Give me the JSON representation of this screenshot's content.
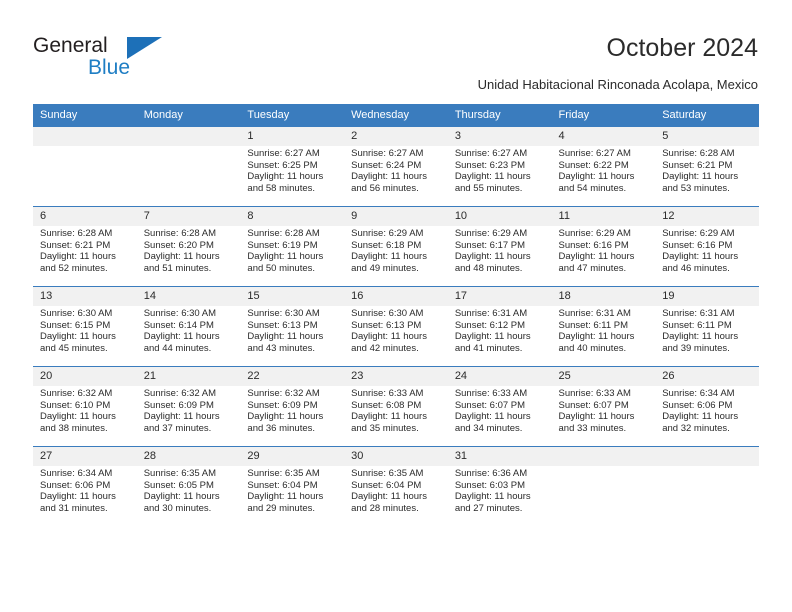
{
  "brand": {
    "line1": "General",
    "line2": "Blue",
    "triangle_color": "#1d70b8"
  },
  "header": {
    "title": "October 2024",
    "subtitle": "Unidad Habitacional Rinconada Acolapa, Mexico"
  },
  "theme": {
    "header_blue": "#3a7cbe",
    "daynum_gray": "#f1f1f1",
    "text": "#2b2b2b",
    "brand_blue": "#1f7ec4"
  },
  "calendar": {
    "weekday_headers": [
      "Sunday",
      "Monday",
      "Tuesday",
      "Wednesday",
      "Thursday",
      "Friday",
      "Saturday"
    ],
    "labels": {
      "sunrise": "Sunrise:",
      "sunset": "Sunset:",
      "daylight": "Daylight:"
    },
    "weeks": [
      [
        {
          "day": "",
          "sunrise": "",
          "sunset": "",
          "daylight": "",
          "blank": true
        },
        {
          "day": "",
          "sunrise": "",
          "sunset": "",
          "daylight": "",
          "blank": true
        },
        {
          "day": "1",
          "sunrise": "Sunrise: 6:27 AM",
          "sunset": "Sunset: 6:25 PM",
          "daylight": "Daylight: 11 hours and 58 minutes."
        },
        {
          "day": "2",
          "sunrise": "Sunrise: 6:27 AM",
          "sunset": "Sunset: 6:24 PM",
          "daylight": "Daylight: 11 hours and 56 minutes."
        },
        {
          "day": "3",
          "sunrise": "Sunrise: 6:27 AM",
          "sunset": "Sunset: 6:23 PM",
          "daylight": "Daylight: 11 hours and 55 minutes."
        },
        {
          "day": "4",
          "sunrise": "Sunrise: 6:27 AM",
          "sunset": "Sunset: 6:22 PM",
          "daylight": "Daylight: 11 hours and 54 minutes."
        },
        {
          "day": "5",
          "sunrise": "Sunrise: 6:28 AM",
          "sunset": "Sunset: 6:21 PM",
          "daylight": "Daylight: 11 hours and 53 minutes."
        }
      ],
      [
        {
          "day": "6",
          "sunrise": "Sunrise: 6:28 AM",
          "sunset": "Sunset: 6:21 PM",
          "daylight": "Daylight: 11 hours and 52 minutes."
        },
        {
          "day": "7",
          "sunrise": "Sunrise: 6:28 AM",
          "sunset": "Sunset: 6:20 PM",
          "daylight": "Daylight: 11 hours and 51 minutes."
        },
        {
          "day": "8",
          "sunrise": "Sunrise: 6:28 AM",
          "sunset": "Sunset: 6:19 PM",
          "daylight": "Daylight: 11 hours and 50 minutes."
        },
        {
          "day": "9",
          "sunrise": "Sunrise: 6:29 AM",
          "sunset": "Sunset: 6:18 PM",
          "daylight": "Daylight: 11 hours and 49 minutes."
        },
        {
          "day": "10",
          "sunrise": "Sunrise: 6:29 AM",
          "sunset": "Sunset: 6:17 PM",
          "daylight": "Daylight: 11 hours and 48 minutes."
        },
        {
          "day": "11",
          "sunrise": "Sunrise: 6:29 AM",
          "sunset": "Sunset: 6:16 PM",
          "daylight": "Daylight: 11 hours and 47 minutes."
        },
        {
          "day": "12",
          "sunrise": "Sunrise: 6:29 AM",
          "sunset": "Sunset: 6:16 PM",
          "daylight": "Daylight: 11 hours and 46 minutes."
        }
      ],
      [
        {
          "day": "13",
          "sunrise": "Sunrise: 6:30 AM",
          "sunset": "Sunset: 6:15 PM",
          "daylight": "Daylight: 11 hours and 45 minutes."
        },
        {
          "day": "14",
          "sunrise": "Sunrise: 6:30 AM",
          "sunset": "Sunset: 6:14 PM",
          "daylight": "Daylight: 11 hours and 44 minutes."
        },
        {
          "day": "15",
          "sunrise": "Sunrise: 6:30 AM",
          "sunset": "Sunset: 6:13 PM",
          "daylight": "Daylight: 11 hours and 43 minutes."
        },
        {
          "day": "16",
          "sunrise": "Sunrise: 6:30 AM",
          "sunset": "Sunset: 6:13 PM",
          "daylight": "Daylight: 11 hours and 42 minutes."
        },
        {
          "day": "17",
          "sunrise": "Sunrise: 6:31 AM",
          "sunset": "Sunset: 6:12 PM",
          "daylight": "Daylight: 11 hours and 41 minutes."
        },
        {
          "day": "18",
          "sunrise": "Sunrise: 6:31 AM",
          "sunset": "Sunset: 6:11 PM",
          "daylight": "Daylight: 11 hours and 40 minutes."
        },
        {
          "day": "19",
          "sunrise": "Sunrise: 6:31 AM",
          "sunset": "Sunset: 6:11 PM",
          "daylight": "Daylight: 11 hours and 39 minutes."
        }
      ],
      [
        {
          "day": "20",
          "sunrise": "Sunrise: 6:32 AM",
          "sunset": "Sunset: 6:10 PM",
          "daylight": "Daylight: 11 hours and 38 minutes."
        },
        {
          "day": "21",
          "sunrise": "Sunrise: 6:32 AM",
          "sunset": "Sunset: 6:09 PM",
          "daylight": "Daylight: 11 hours and 37 minutes."
        },
        {
          "day": "22",
          "sunrise": "Sunrise: 6:32 AM",
          "sunset": "Sunset: 6:09 PM",
          "daylight": "Daylight: 11 hours and 36 minutes."
        },
        {
          "day": "23",
          "sunrise": "Sunrise: 6:33 AM",
          "sunset": "Sunset: 6:08 PM",
          "daylight": "Daylight: 11 hours and 35 minutes."
        },
        {
          "day": "24",
          "sunrise": "Sunrise: 6:33 AM",
          "sunset": "Sunset: 6:07 PM",
          "daylight": "Daylight: 11 hours and 34 minutes."
        },
        {
          "day": "25",
          "sunrise": "Sunrise: 6:33 AM",
          "sunset": "Sunset: 6:07 PM",
          "daylight": "Daylight: 11 hours and 33 minutes."
        },
        {
          "day": "26",
          "sunrise": "Sunrise: 6:34 AM",
          "sunset": "Sunset: 6:06 PM",
          "daylight": "Daylight: 11 hours and 32 minutes."
        }
      ],
      [
        {
          "day": "27",
          "sunrise": "Sunrise: 6:34 AM",
          "sunset": "Sunset: 6:06 PM",
          "daylight": "Daylight: 11 hours and 31 minutes."
        },
        {
          "day": "28",
          "sunrise": "Sunrise: 6:35 AM",
          "sunset": "Sunset: 6:05 PM",
          "daylight": "Daylight: 11 hours and 30 minutes."
        },
        {
          "day": "29",
          "sunrise": "Sunrise: 6:35 AM",
          "sunset": "Sunset: 6:04 PM",
          "daylight": "Daylight: 11 hours and 29 minutes."
        },
        {
          "day": "30",
          "sunrise": "Sunrise: 6:35 AM",
          "sunset": "Sunset: 6:04 PM",
          "daylight": "Daylight: 11 hours and 28 minutes."
        },
        {
          "day": "31",
          "sunrise": "Sunrise: 6:36 AM",
          "sunset": "Sunset: 6:03 PM",
          "daylight": "Daylight: 11 hours and 27 minutes."
        },
        {
          "day": "",
          "sunrise": "",
          "sunset": "",
          "daylight": "",
          "blank": true
        },
        {
          "day": "",
          "sunrise": "",
          "sunset": "",
          "daylight": "",
          "blank": true
        }
      ]
    ]
  }
}
